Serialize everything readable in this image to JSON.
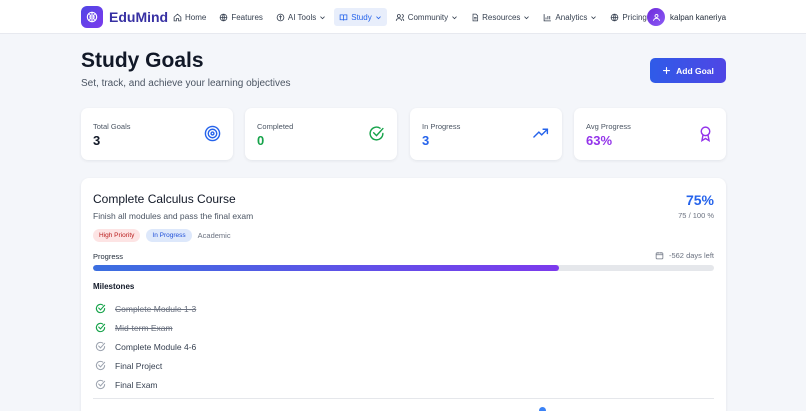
{
  "brand": {
    "name": "EduMind"
  },
  "nav": {
    "items": [
      {
        "label": "Home",
        "icon": "home-icon",
        "active": false,
        "dropdown": false
      },
      {
        "label": "Features",
        "icon": "features-icon",
        "active": false,
        "dropdown": false
      },
      {
        "label": "AI Tools",
        "icon": "ai-tools-icon",
        "active": false,
        "dropdown": true
      },
      {
        "label": "Study",
        "icon": "book-icon",
        "active": true,
        "dropdown": true
      },
      {
        "label": "Community",
        "icon": "users-icon",
        "active": false,
        "dropdown": true
      },
      {
        "label": "Resources",
        "icon": "file-icon",
        "active": false,
        "dropdown": true
      },
      {
        "label": "Analytics",
        "icon": "bar-chart-icon",
        "active": false,
        "dropdown": true
      },
      {
        "label": "Pricing",
        "icon": "pricing-icon",
        "active": false,
        "dropdown": false
      }
    ],
    "user_name": "kalpan kaneriya"
  },
  "header": {
    "title": "Study Goals",
    "subtitle": "Set, track, and achieve your learning objectives",
    "add_button": "Add Goal"
  },
  "stats": [
    {
      "label": "Total Goals",
      "value": "3",
      "color": "#111827",
      "icon": "target-icon"
    },
    {
      "label": "Completed",
      "value": "0",
      "color": "#16a34a",
      "icon": "check-circle-icon"
    },
    {
      "label": "In Progress",
      "value": "3",
      "color": "#2563eb",
      "icon": "trending-up-icon"
    },
    {
      "label": "Avg Progress",
      "value": "63%",
      "color": "#9333ea",
      "icon": "award-icon"
    }
  ],
  "goal": {
    "title": "Complete Calculus Course",
    "description": "Finish all modules and pass the final exam",
    "percent": "75%",
    "count": "75 / 100 %",
    "progress_fraction": 0.75,
    "priority": "High Priority",
    "status": "In Progress",
    "category": "Academic",
    "progress_label": "Progress",
    "days_left": "-562 days left",
    "milestones_title": "Milestones",
    "milestones": [
      {
        "label": "Complete Module 1-3",
        "done": true
      },
      {
        "label": "Mid-term Exam",
        "done": true
      },
      {
        "label": "Complete Module 4-6",
        "done": false
      },
      {
        "label": "Final Project",
        "done": false
      },
      {
        "label": "Final Exam",
        "done": false
      }
    ]
  },
  "colors": {
    "accent": "#2563eb",
    "brand": "#4f46e5",
    "success": "#16a34a",
    "purple": "#9333ea"
  }
}
